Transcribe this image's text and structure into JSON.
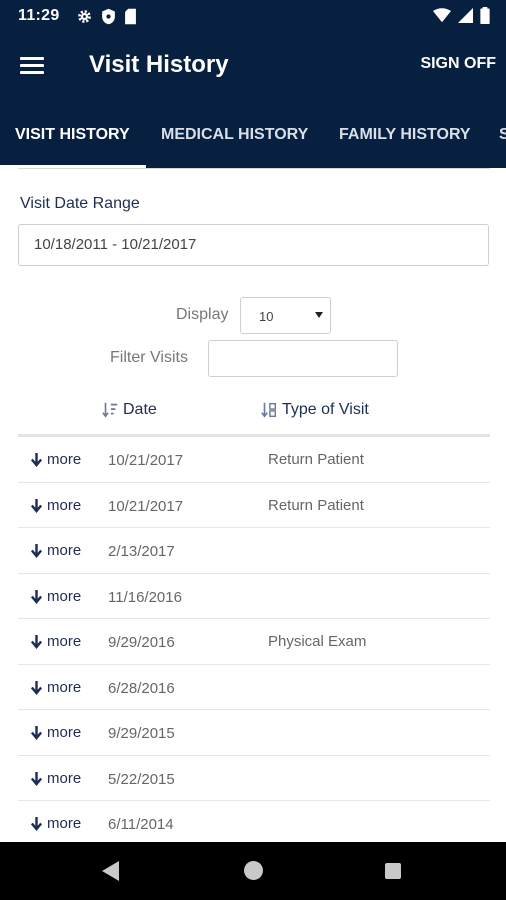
{
  "status_bar": {
    "time": "11:29",
    "left_icons": [
      "gear-icon",
      "shield-icon",
      "sd-card-icon"
    ],
    "right_icons": [
      "wifi-icon",
      "signal-icon",
      "battery-icon"
    ]
  },
  "app_bar": {
    "title": "Visit History",
    "sign_off_label": "SIGN OFF",
    "menu_icon": "hamburger-menu-icon"
  },
  "tabs": [
    {
      "label": "VISIT HISTORY",
      "active": true
    },
    {
      "label": "MEDICAL HISTORY",
      "active": false
    },
    {
      "label": "FAMILY HISTORY",
      "active": false
    },
    {
      "label": "S",
      "active": false
    }
  ],
  "filters": {
    "date_range_label": "Visit Date Range",
    "date_range_value": "10/18/2011 - 10/21/2017",
    "display_label": "Display",
    "display_value": "10",
    "filter_label": "Filter Visits",
    "filter_value": ""
  },
  "table": {
    "columns": [
      "Date",
      "Type of Visit"
    ],
    "more_label": "more",
    "rows": [
      {
        "date": "10/21/2017",
        "type": "Return Patient"
      },
      {
        "date": "10/21/2017",
        "type": "Return Patient"
      },
      {
        "date": "2/13/2017",
        "type": ""
      },
      {
        "date": "11/16/2016",
        "type": ""
      },
      {
        "date": "9/29/2016",
        "type": "Physical Exam"
      },
      {
        "date": "6/28/2016",
        "type": ""
      },
      {
        "date": "9/29/2015",
        "type": ""
      },
      {
        "date": "5/22/2015",
        "type": ""
      },
      {
        "date": "6/11/2014",
        "type": ""
      }
    ]
  },
  "colors": {
    "primary": "#08203f",
    "text_accent": "#1f2d55"
  }
}
